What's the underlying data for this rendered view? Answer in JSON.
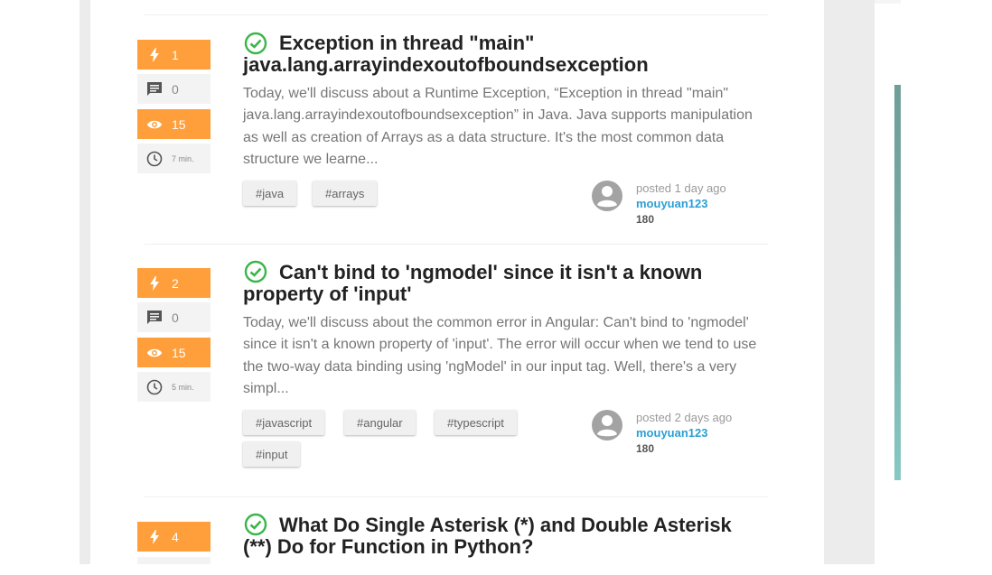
{
  "posts": [
    {
      "votes": "1",
      "comments": "0",
      "views": "15",
      "read_time": "7 min.",
      "title_line1": "Exception in thread \"main\"",
      "title_line2": "java.lang.arrayindexoutofboundsexception",
      "excerpt": "Today, we'll discuss about a Runtime Exception, “Exception in thread \"main\" java.lang.arrayindexoutofboundsexception” in Java. Java supports manipulation as well as creation of Arrays as a data structure. It's the most common data structure we learne...",
      "tags": [
        "java",
        "arrays"
      ],
      "posted": "posted 1 day ago",
      "author": "mouyuan123",
      "reputation": "180"
    },
    {
      "votes": "2",
      "comments": "0",
      "views": "15",
      "read_time": "5 min.",
      "title_line1": "Can't bind to 'ngmodel' since it isn't a known",
      "title_line2": "property of 'input'",
      "excerpt": "Today, we'll discuss about the common error in Angular: Can't bind to 'ngmodel' since it isn't a known property of 'input'. The error will occur when we tend to use the two-way data binding using 'ngModel' in our input tag. Well, there's a very simpl...",
      "tags": [
        "javascript",
        "angular",
        "typescript",
        "input"
      ],
      "posted": "posted 2 days ago",
      "author": "mouyuan123",
      "reputation": "180"
    },
    {
      "votes": "4",
      "title_line1": "What Do Single Asterisk (*) and Double Asterisk",
      "title_line2": "(**) Do for Function in Python?"
    }
  ],
  "tag_prefix": "#",
  "colors": {
    "accent_orange": "#fe9f3c",
    "check_green": "#3bb54a",
    "author_blue": "#2a9fd6"
  },
  "icons": {
    "votes": "bolt-icon",
    "comments": "comment-icon",
    "views": "eye-icon",
    "read_time": "clock-icon",
    "accepted": "check-circle-icon",
    "avatar": "user-avatar-icon"
  }
}
